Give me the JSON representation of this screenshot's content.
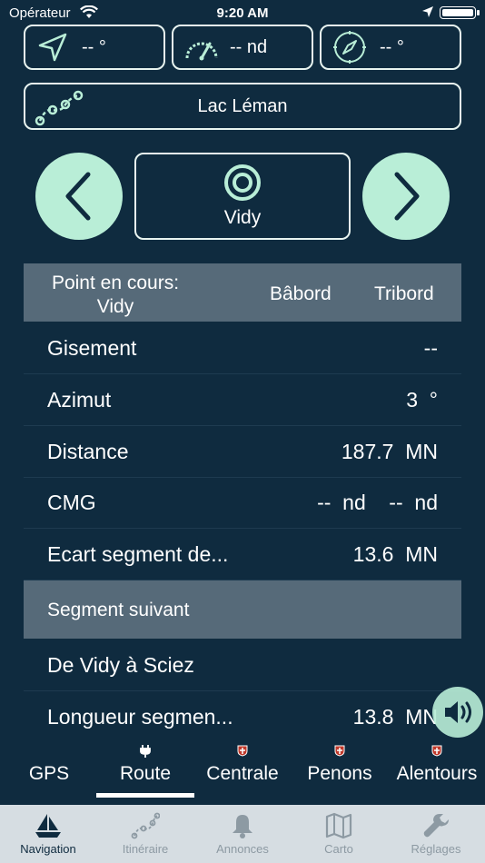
{
  "status": {
    "carrier": "Opérateur",
    "time": "9:20 AM"
  },
  "instruments": {
    "heading": "-- °",
    "speed": "-- nd",
    "compass": "-- °"
  },
  "route_name": "Lac Léman",
  "waypoint": {
    "name": "Vidy"
  },
  "table": {
    "header": {
      "current_line1": "Point en cours:",
      "current_line2": "Vidy",
      "port": "Bâbord",
      "starboard": "Tribord"
    },
    "rows": [
      {
        "label": "Gisement",
        "value": "--"
      },
      {
        "label": "Azimut",
        "value": "3  °"
      },
      {
        "label": "Distance",
        "value": "187.7  MN"
      },
      {
        "label": "CMG",
        "value": "--  nd    --  nd"
      },
      {
        "label": "Ecart segment de...",
        "value": "13.6  MN"
      }
    ],
    "section": "Segment suivant",
    "next_rows": [
      {
        "label": "De Vidy à Sciez",
        "value": ""
      },
      {
        "label": "Longueur segmen...",
        "value": "13.8  MN"
      }
    ]
  },
  "tabs": [
    "GPS",
    "Route",
    "Centrale",
    "Penons",
    "Alentours"
  ],
  "active_tab": "Route",
  "tabbar": [
    {
      "label": "Navigation",
      "icon": "sailboat-icon"
    },
    {
      "label": "Itinéraire",
      "icon": "route-icon"
    },
    {
      "label": "Annonces",
      "icon": "bell-icon"
    },
    {
      "label": "Carto",
      "icon": "map-icon"
    },
    {
      "label": "Réglages",
      "icon": "wrench-icon"
    }
  ],
  "colors": {
    "background": "#0f2b3f",
    "accent": "#b9eed7",
    "header": "#566a79",
    "tabbar": "#d6dde2",
    "flag": "#c0392b"
  }
}
